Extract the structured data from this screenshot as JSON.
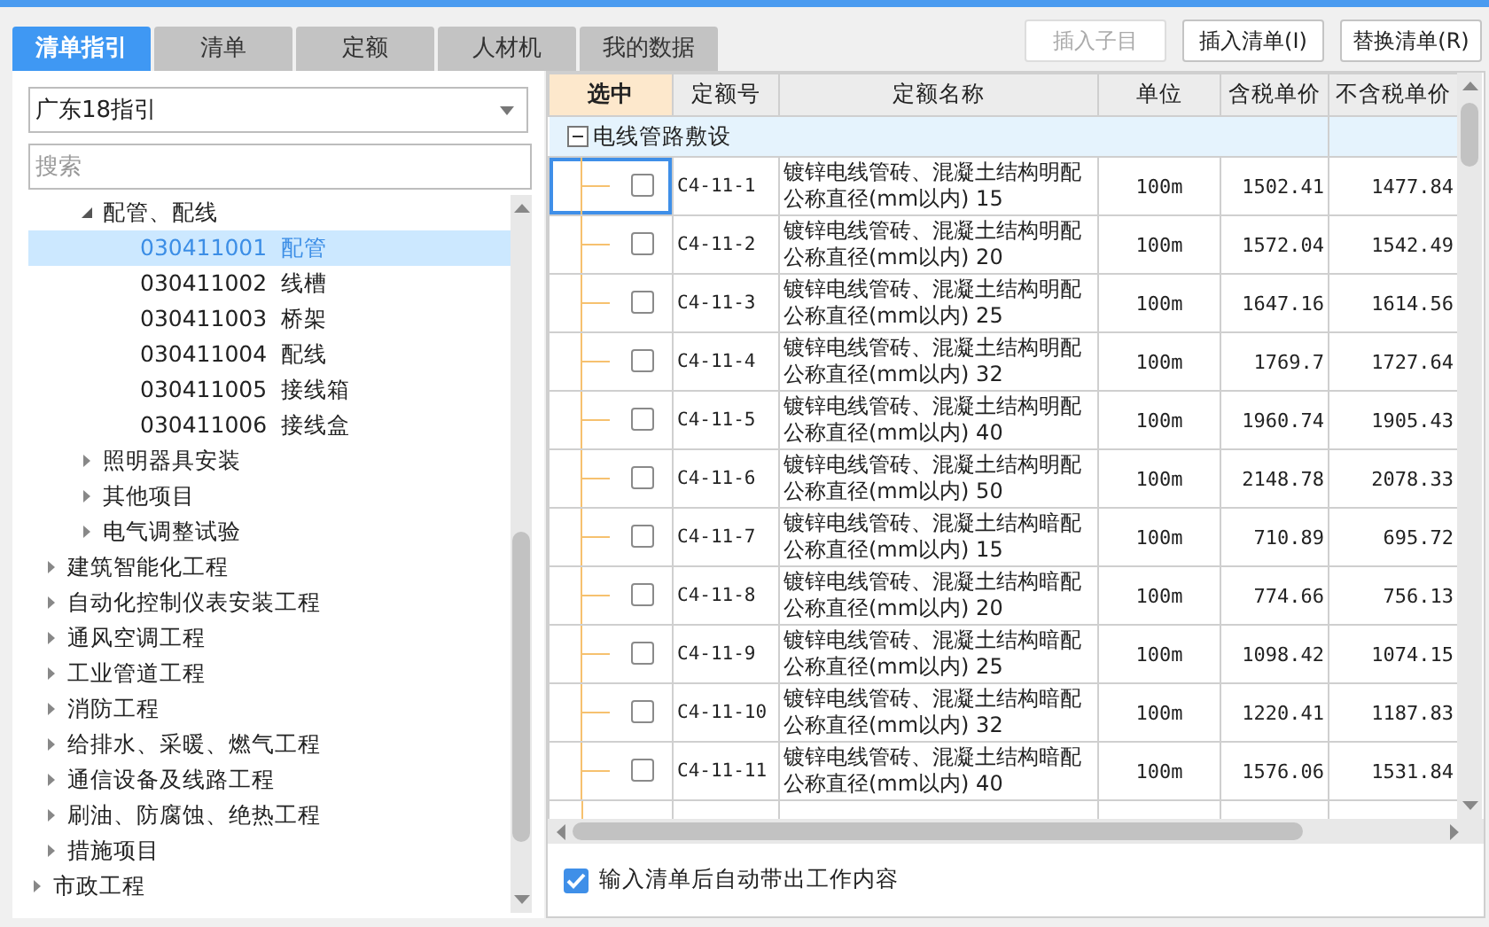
{
  "tabs": [
    {
      "label": "清单指引",
      "selected": true
    },
    {
      "label": "清单",
      "selected": false
    },
    {
      "label": "定额",
      "selected": false
    },
    {
      "label": "人材机",
      "selected": false
    },
    {
      "label": "我的数据",
      "selected": false
    }
  ],
  "buttons": [
    {
      "label": "插入子目",
      "disabled": true
    },
    {
      "label": "插入清单(I)",
      "disabled": false
    },
    {
      "label": "替换清单(R)",
      "disabled": false
    }
  ],
  "guide_select": {
    "value": "广东18指引"
  },
  "search": {
    "placeholder": "搜索"
  },
  "tree": [
    {
      "children": [
        {
          "children": [
            {
              "label": "配管、配线",
              "expanded": true,
              "selected": false,
              "children": [
                {
                  "code": "030411001",
                  "label": "配管",
                  "selected": true
                },
                {
                  "code": "030411002",
                  "label": "线槽",
                  "selected": false
                },
                {
                  "code": "030411003",
                  "label": "桥架",
                  "selected": false
                },
                {
                  "code": "030411004",
                  "label": "配线",
                  "selected": false
                },
                {
                  "code": "030411005",
                  "label": "接线箱",
                  "selected": false
                },
                {
                  "code": "030411006",
                  "label": "接线盒",
                  "selected": false
                }
              ]
            },
            {
              "label": "照明器具安装",
              "expanded": false,
              "selected": false
            },
            {
              "label": "其他项目",
              "expanded": false,
              "selected": false
            },
            {
              "label": "电气调整试验",
              "expanded": false,
              "selected": false
            }
          ]
        },
        {
          "label": "建筑智能化工程",
          "expanded": false,
          "selected": false
        },
        {
          "label": "自动化控制仪表安装工程",
          "expanded": false,
          "selected": false
        },
        {
          "label": "通风空调工程",
          "expanded": false,
          "selected": false
        },
        {
          "label": "工业管道工程",
          "expanded": false,
          "selected": false
        },
        {
          "label": "消防工程",
          "expanded": false,
          "selected": false
        },
        {
          "label": "给排水、采暖、燃气工程",
          "expanded": false,
          "selected": false
        },
        {
          "label": "通信设备及线路工程",
          "expanded": false,
          "selected": false
        },
        {
          "label": "刷油、防腐蚀、绝热工程",
          "expanded": false,
          "selected": false
        },
        {
          "label": "措施项目",
          "expanded": false,
          "selected": false
        }
      ]
    },
    {
      "label": "市政工程",
      "expanded": false,
      "selected": false
    }
  ],
  "table": {
    "columns": [
      "选中",
      "定额号",
      "定额名称",
      "单位",
      "含税单价",
      "不含税单价"
    ],
    "group": {
      "label": "电线管路敷设",
      "expanded": true
    },
    "rows": [
      {
        "code": "C4-11-1",
        "name": "镀锌电线管砖、混凝土结构明配公称直径(mm以内) 15",
        "unit": "100m",
        "price_tax": "1502.41",
        "price_notax": "1477.84",
        "checked": false,
        "current": true
      },
      {
        "code": "C4-11-2",
        "name": "镀锌电线管砖、混凝土结构明配公称直径(mm以内) 20",
        "unit": "100m",
        "price_tax": "1572.04",
        "price_notax": "1542.49",
        "checked": false,
        "current": false
      },
      {
        "code": "C4-11-3",
        "name": "镀锌电线管砖、混凝土结构明配公称直径(mm以内) 25",
        "unit": "100m",
        "price_tax": "1647.16",
        "price_notax": "1614.56",
        "checked": false,
        "current": false
      },
      {
        "code": "C4-11-4",
        "name": "镀锌电线管砖、混凝土结构明配公称直径(mm以内) 32",
        "unit": "100m",
        "price_tax": "1769.7",
        "price_notax": "1727.64",
        "checked": false,
        "current": false
      },
      {
        "code": "C4-11-5",
        "name": "镀锌电线管砖、混凝土结构明配公称直径(mm以内) 40",
        "unit": "100m",
        "price_tax": "1960.74",
        "price_notax": "1905.43",
        "checked": false,
        "current": false
      },
      {
        "code": "C4-11-6",
        "name": "镀锌电线管砖、混凝土结构明配公称直径(mm以内) 50",
        "unit": "100m",
        "price_tax": "2148.78",
        "price_notax": "2078.33",
        "checked": false,
        "current": false
      },
      {
        "code": "C4-11-7",
        "name": "镀锌电线管砖、混凝土结构暗配公称直径(mm以内) 15",
        "unit": "100m",
        "price_tax": "710.89",
        "price_notax": "695.72",
        "checked": false,
        "current": false
      },
      {
        "code": "C4-11-8",
        "name": "镀锌电线管砖、混凝土结构暗配公称直径(mm以内) 20",
        "unit": "100m",
        "price_tax": "774.66",
        "price_notax": "756.13",
        "checked": false,
        "current": false
      },
      {
        "code": "C4-11-9",
        "name": "镀锌电线管砖、混凝土结构暗配公称直径(mm以内) 25",
        "unit": "100m",
        "price_tax": "1098.42",
        "price_notax": "1074.15",
        "checked": false,
        "current": false
      },
      {
        "code": "C4-11-10",
        "name": "镀锌电线管砖、混凝土结构暗配公称直径(mm以内) 32",
        "unit": "100m",
        "price_tax": "1220.41",
        "price_notax": "1187.83",
        "checked": false,
        "current": false
      },
      {
        "code": "C4-11-11",
        "name": "镀锌电线管砖、混凝土结构暗配公称直径(mm以内) 40",
        "unit": "100m",
        "price_tax": "1576.06",
        "price_notax": "1531.84",
        "checked": false,
        "current": false
      }
    ]
  },
  "auto_option": {
    "label": "输入清单后自动带出工作内容",
    "checked": true
  }
}
